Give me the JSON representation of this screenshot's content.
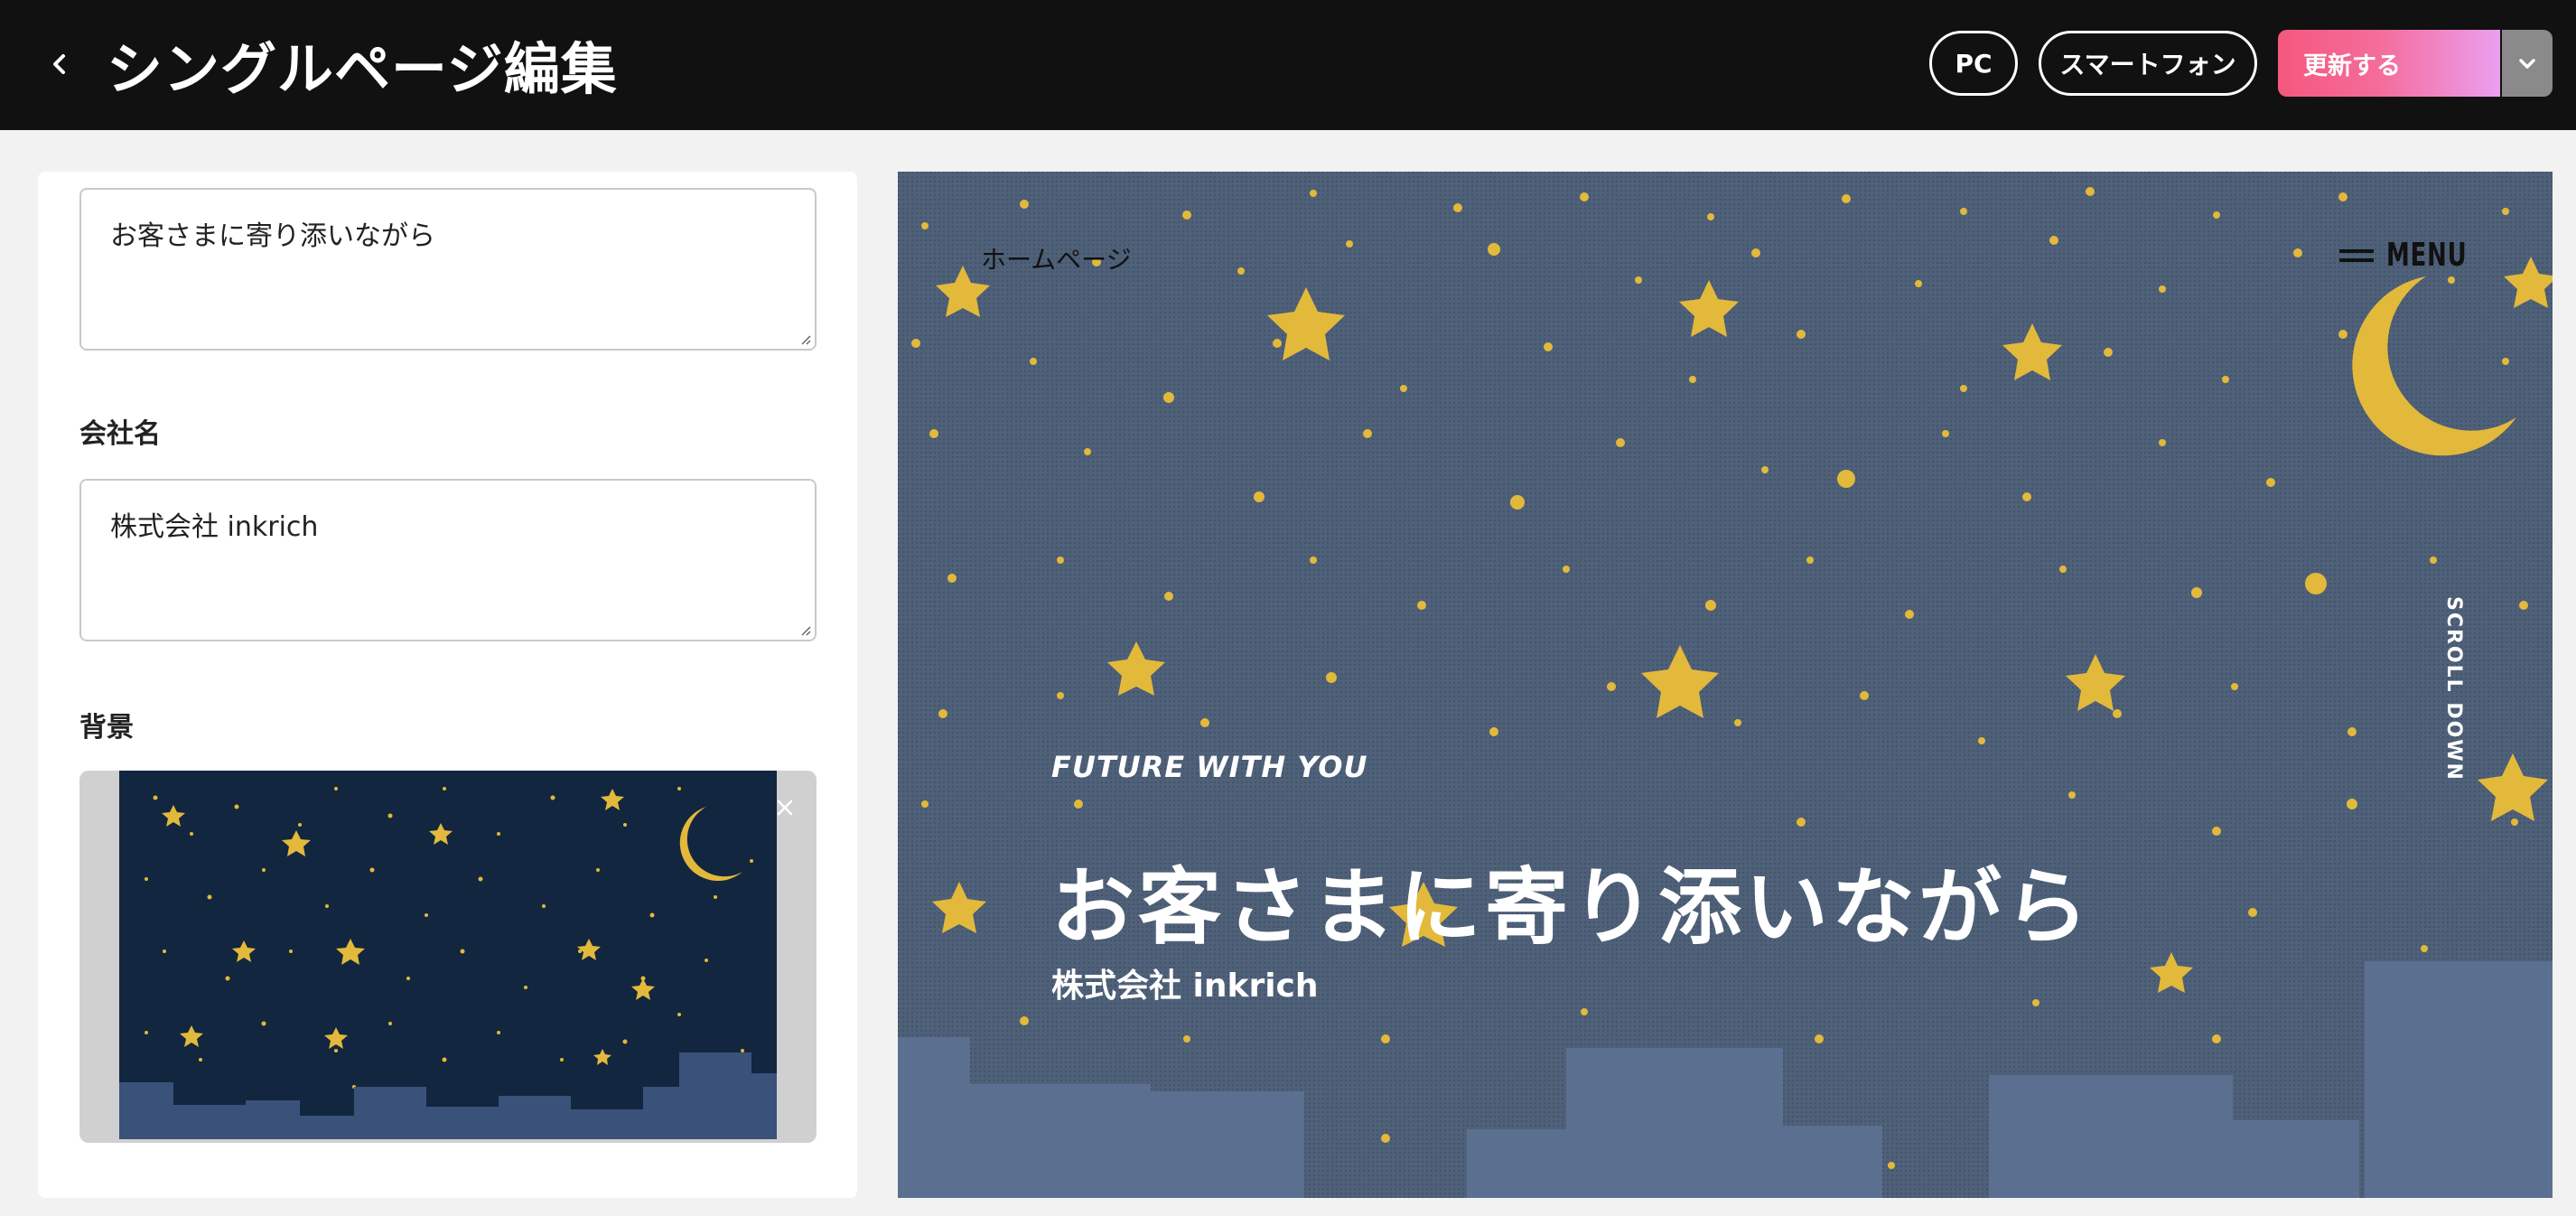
{
  "header": {
    "title": "シングルページ編集",
    "view_pc": "PC",
    "view_smartphone": "スマートフォン",
    "update_label": "更新する"
  },
  "form": {
    "catchcopy_value": "お客さまに寄り添いながら",
    "company_label": "会社名",
    "company_value": "株式会社 inkrich",
    "background_label": "背景"
  },
  "preview": {
    "logo": "ホームページ",
    "menu": "MENU",
    "scroll": "SCROLL DOWN",
    "subtitle": "FUTURE WITH YOU",
    "catchcopy": "お客さまに寄り添いながら",
    "company": "株式会社 inkrich"
  },
  "colors": {
    "header_bg": "#111111",
    "update_gradient_start": "#f4587e",
    "update_gradient_end": "#ec9ff0",
    "sky_preview": "#4f6079",
    "sky_thumbnail": "#13263f",
    "star": "#e2b93b",
    "buildings": "#5b7090"
  },
  "icons": [
    "chevron-left-icon",
    "chevron-down-icon",
    "close-icon",
    "menu-lines-icon",
    "resize-handle-icon"
  ]
}
